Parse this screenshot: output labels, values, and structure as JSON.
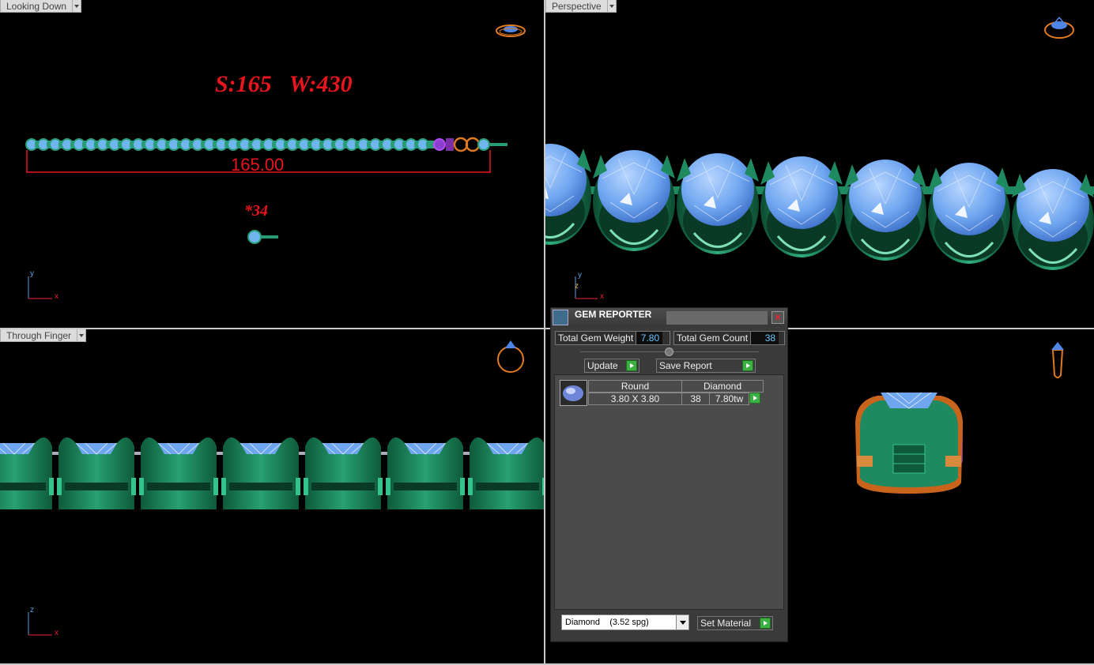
{
  "viewports": {
    "top_left": {
      "label": "Looking Down"
    },
    "top_right": {
      "label": "Perspective"
    },
    "bottom_left": {
      "label": "Through Finger"
    },
    "bottom_right": {
      "label": ""
    }
  },
  "annotations": {
    "size_weight": "S:165   W:430",
    "dimension": "165.00",
    "stone_count": "*34"
  },
  "axes": {
    "top_left": {
      "up": "y",
      "right": "x"
    },
    "top_right": {
      "up": "y",
      "mid": "z",
      "right": "x"
    },
    "bottom_left": {
      "up": "z",
      "right": "x"
    }
  },
  "gem_reporter": {
    "title": "GEM REPORTER",
    "total_weight_label": "Total Gem Weight",
    "total_weight_value": "7.80",
    "total_count_label": "Total Gem Count",
    "total_count_value": "38",
    "update_label": "Update",
    "save_report_label": "Save Report",
    "gems": [
      {
        "shape": "Round",
        "material": "Diamond",
        "size": "3.80 X 3.80",
        "count": "38",
        "weight": "7.80tw"
      }
    ],
    "material_select": "Diamond    (3.52 spg)",
    "set_material_label": "Set Material"
  },
  "colors": {
    "metal_green": "#1f8a60",
    "gem_blue": "#6fa6f0",
    "annotation_red": "#e8141e",
    "icon_orange": "#e07a20",
    "accent_green": "#3cb043"
  },
  "icons": {
    "top_left": "ring-lying-flat-icon",
    "top_right": "ring-perspective-icon",
    "bottom_left": "ring-front-icon",
    "bottom_right": "ring-side-icon"
  }
}
